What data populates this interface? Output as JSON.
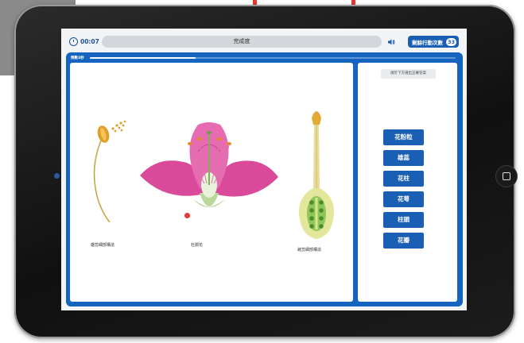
{
  "timer": "00:07",
  "header": {
    "progress_label": "完成度"
  },
  "moves": {
    "label": "剩餘行動次數",
    "count": "33"
  },
  "task": {
    "time_label": "倒數3秒",
    "progress_fraction": 0.29
  },
  "instruction": "請於下方選出正確答案",
  "answers": [
    {
      "label": "花粉粒"
    },
    {
      "label": "雄蕊"
    },
    {
      "label": "花柱"
    },
    {
      "label": "花萼"
    },
    {
      "label": "柱頭"
    },
    {
      "label": "花瓣"
    }
  ],
  "captions": {
    "stamen": "雄蕊細部構造",
    "flower": "杜鵑花",
    "pistil": "雌蕊細部構造"
  },
  "colors": {
    "primary": "#1a5fb4",
    "frame": "#1565c0",
    "petal": "#e0559e",
    "marker": "#e53935"
  },
  "icons": [
    "clock-icon",
    "speaker-icon"
  ]
}
